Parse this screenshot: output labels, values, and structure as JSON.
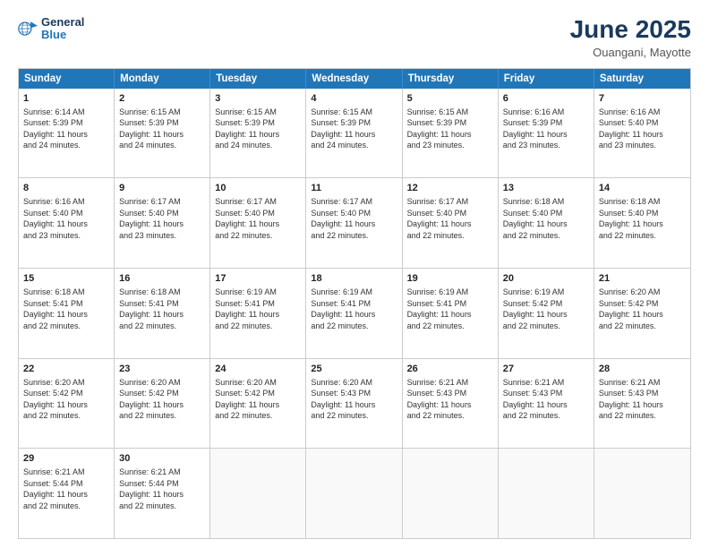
{
  "logo": {
    "line1": "General",
    "line2": "Blue"
  },
  "title": "June 2025",
  "location": "Ouangani, Mayotte",
  "header_days": [
    "Sunday",
    "Monday",
    "Tuesday",
    "Wednesday",
    "Thursday",
    "Friday",
    "Saturday"
  ],
  "weeks": [
    [
      {
        "day": "1",
        "lines": [
          "Sunrise: 6:14 AM",
          "Sunset: 5:39 PM",
          "Daylight: 11 hours",
          "and 24 minutes."
        ]
      },
      {
        "day": "2",
        "lines": [
          "Sunrise: 6:15 AM",
          "Sunset: 5:39 PM",
          "Daylight: 11 hours",
          "and 24 minutes."
        ]
      },
      {
        "day": "3",
        "lines": [
          "Sunrise: 6:15 AM",
          "Sunset: 5:39 PM",
          "Daylight: 11 hours",
          "and 24 minutes."
        ]
      },
      {
        "day": "4",
        "lines": [
          "Sunrise: 6:15 AM",
          "Sunset: 5:39 PM",
          "Daylight: 11 hours",
          "and 24 minutes."
        ]
      },
      {
        "day": "5",
        "lines": [
          "Sunrise: 6:15 AM",
          "Sunset: 5:39 PM",
          "Daylight: 11 hours",
          "and 23 minutes."
        ]
      },
      {
        "day": "6",
        "lines": [
          "Sunrise: 6:16 AM",
          "Sunset: 5:39 PM",
          "Daylight: 11 hours",
          "and 23 minutes."
        ]
      },
      {
        "day": "7",
        "lines": [
          "Sunrise: 6:16 AM",
          "Sunset: 5:40 PM",
          "Daylight: 11 hours",
          "and 23 minutes."
        ]
      }
    ],
    [
      {
        "day": "8",
        "lines": [
          "Sunrise: 6:16 AM",
          "Sunset: 5:40 PM",
          "Daylight: 11 hours",
          "and 23 minutes."
        ]
      },
      {
        "day": "9",
        "lines": [
          "Sunrise: 6:17 AM",
          "Sunset: 5:40 PM",
          "Daylight: 11 hours",
          "and 23 minutes."
        ]
      },
      {
        "day": "10",
        "lines": [
          "Sunrise: 6:17 AM",
          "Sunset: 5:40 PM",
          "Daylight: 11 hours",
          "and 22 minutes."
        ]
      },
      {
        "day": "11",
        "lines": [
          "Sunrise: 6:17 AM",
          "Sunset: 5:40 PM",
          "Daylight: 11 hours",
          "and 22 minutes."
        ]
      },
      {
        "day": "12",
        "lines": [
          "Sunrise: 6:17 AM",
          "Sunset: 5:40 PM",
          "Daylight: 11 hours",
          "and 22 minutes."
        ]
      },
      {
        "day": "13",
        "lines": [
          "Sunrise: 6:18 AM",
          "Sunset: 5:40 PM",
          "Daylight: 11 hours",
          "and 22 minutes."
        ]
      },
      {
        "day": "14",
        "lines": [
          "Sunrise: 6:18 AM",
          "Sunset: 5:40 PM",
          "Daylight: 11 hours",
          "and 22 minutes."
        ]
      }
    ],
    [
      {
        "day": "15",
        "lines": [
          "Sunrise: 6:18 AM",
          "Sunset: 5:41 PM",
          "Daylight: 11 hours",
          "and 22 minutes."
        ]
      },
      {
        "day": "16",
        "lines": [
          "Sunrise: 6:18 AM",
          "Sunset: 5:41 PM",
          "Daylight: 11 hours",
          "and 22 minutes."
        ]
      },
      {
        "day": "17",
        "lines": [
          "Sunrise: 6:19 AM",
          "Sunset: 5:41 PM",
          "Daylight: 11 hours",
          "and 22 minutes."
        ]
      },
      {
        "day": "18",
        "lines": [
          "Sunrise: 6:19 AM",
          "Sunset: 5:41 PM",
          "Daylight: 11 hours",
          "and 22 minutes."
        ]
      },
      {
        "day": "19",
        "lines": [
          "Sunrise: 6:19 AM",
          "Sunset: 5:41 PM",
          "Daylight: 11 hours",
          "and 22 minutes."
        ]
      },
      {
        "day": "20",
        "lines": [
          "Sunrise: 6:19 AM",
          "Sunset: 5:42 PM",
          "Daylight: 11 hours",
          "and 22 minutes."
        ]
      },
      {
        "day": "21",
        "lines": [
          "Sunrise: 6:20 AM",
          "Sunset: 5:42 PM",
          "Daylight: 11 hours",
          "and 22 minutes."
        ]
      }
    ],
    [
      {
        "day": "22",
        "lines": [
          "Sunrise: 6:20 AM",
          "Sunset: 5:42 PM",
          "Daylight: 11 hours",
          "and 22 minutes."
        ]
      },
      {
        "day": "23",
        "lines": [
          "Sunrise: 6:20 AM",
          "Sunset: 5:42 PM",
          "Daylight: 11 hours",
          "and 22 minutes."
        ]
      },
      {
        "day": "24",
        "lines": [
          "Sunrise: 6:20 AM",
          "Sunset: 5:42 PM",
          "Daylight: 11 hours",
          "and 22 minutes."
        ]
      },
      {
        "day": "25",
        "lines": [
          "Sunrise: 6:20 AM",
          "Sunset: 5:43 PM",
          "Daylight: 11 hours",
          "and 22 minutes."
        ]
      },
      {
        "day": "26",
        "lines": [
          "Sunrise: 6:21 AM",
          "Sunset: 5:43 PM",
          "Daylight: 11 hours",
          "and 22 minutes."
        ]
      },
      {
        "day": "27",
        "lines": [
          "Sunrise: 6:21 AM",
          "Sunset: 5:43 PM",
          "Daylight: 11 hours",
          "and 22 minutes."
        ]
      },
      {
        "day": "28",
        "lines": [
          "Sunrise: 6:21 AM",
          "Sunset: 5:43 PM",
          "Daylight: 11 hours",
          "and 22 minutes."
        ]
      }
    ],
    [
      {
        "day": "29",
        "lines": [
          "Sunrise: 6:21 AM",
          "Sunset: 5:44 PM",
          "Daylight: 11 hours",
          "and 22 minutes."
        ]
      },
      {
        "day": "30",
        "lines": [
          "Sunrise: 6:21 AM",
          "Sunset: 5:44 PM",
          "Daylight: 11 hours",
          "and 22 minutes."
        ]
      },
      {
        "day": "",
        "lines": []
      },
      {
        "day": "",
        "lines": []
      },
      {
        "day": "",
        "lines": []
      },
      {
        "day": "",
        "lines": []
      },
      {
        "day": "",
        "lines": []
      }
    ]
  ]
}
